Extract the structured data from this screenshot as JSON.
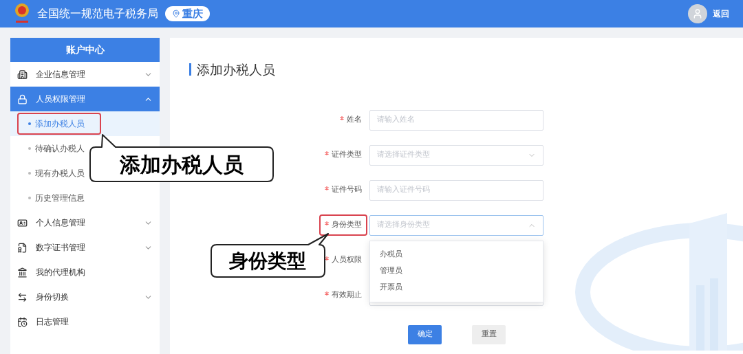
{
  "header": {
    "title": "全国统一规范电子税务局",
    "location": "重庆",
    "user_link": "返回"
  },
  "sidebar": {
    "title": "账户中心",
    "items": [
      {
        "label": "企业信息管理",
        "kind": "group",
        "expanded": false,
        "selected": false
      },
      {
        "label": "人员权限管理",
        "kind": "group",
        "expanded": true,
        "selected": true,
        "children": [
          {
            "label": "添加办税人员",
            "selected": true,
            "highlighted": true
          },
          {
            "label": "待确认办税人",
            "selected": false,
            "highlighted": false
          },
          {
            "label": "现有办税人员",
            "selected": false,
            "highlighted": false
          },
          {
            "label": "历史管理信息",
            "selected": false,
            "highlighted": false
          }
        ]
      },
      {
        "label": "个人信息管理",
        "kind": "group",
        "expanded": false,
        "selected": false
      },
      {
        "label": "数字证书管理",
        "kind": "group",
        "expanded": false,
        "selected": false
      },
      {
        "label": "我的代理机构",
        "kind": "link",
        "selected": false
      },
      {
        "label": "身份切换",
        "kind": "group",
        "expanded": false,
        "selected": false
      },
      {
        "label": "日志管理",
        "kind": "link",
        "selected": false
      }
    ]
  },
  "form": {
    "title": "添加办税人员",
    "fields": [
      {
        "label": "姓名",
        "required": true,
        "kind": "text",
        "placeholder": "请输入姓名",
        "highlighted": false
      },
      {
        "label": "证件类型",
        "required": true,
        "kind": "select",
        "placeholder": "请选择证件类型",
        "open": false,
        "highlighted": false
      },
      {
        "label": "证件号码",
        "required": true,
        "kind": "text",
        "placeholder": "请输入证件号码",
        "highlighted": false
      },
      {
        "label": "身份类型",
        "required": true,
        "kind": "select",
        "placeholder": "请选择身份类型",
        "open": true,
        "highlighted": true,
        "options": [
          "办税员",
          "管理员",
          "开票员"
        ]
      },
      {
        "label": "人员权限",
        "required": true,
        "kind": "covered",
        "highlighted": false
      },
      {
        "label": "有效期止",
        "required": true,
        "kind": "text",
        "highlighted": false
      }
    ],
    "buttons": [
      {
        "label": "确定",
        "kind": "primary"
      },
      {
        "label": "重置",
        "kind": "secondary"
      }
    ]
  },
  "annotations": [
    {
      "text": "添加办税人员"
    },
    {
      "text": "身份类型"
    }
  ]
}
